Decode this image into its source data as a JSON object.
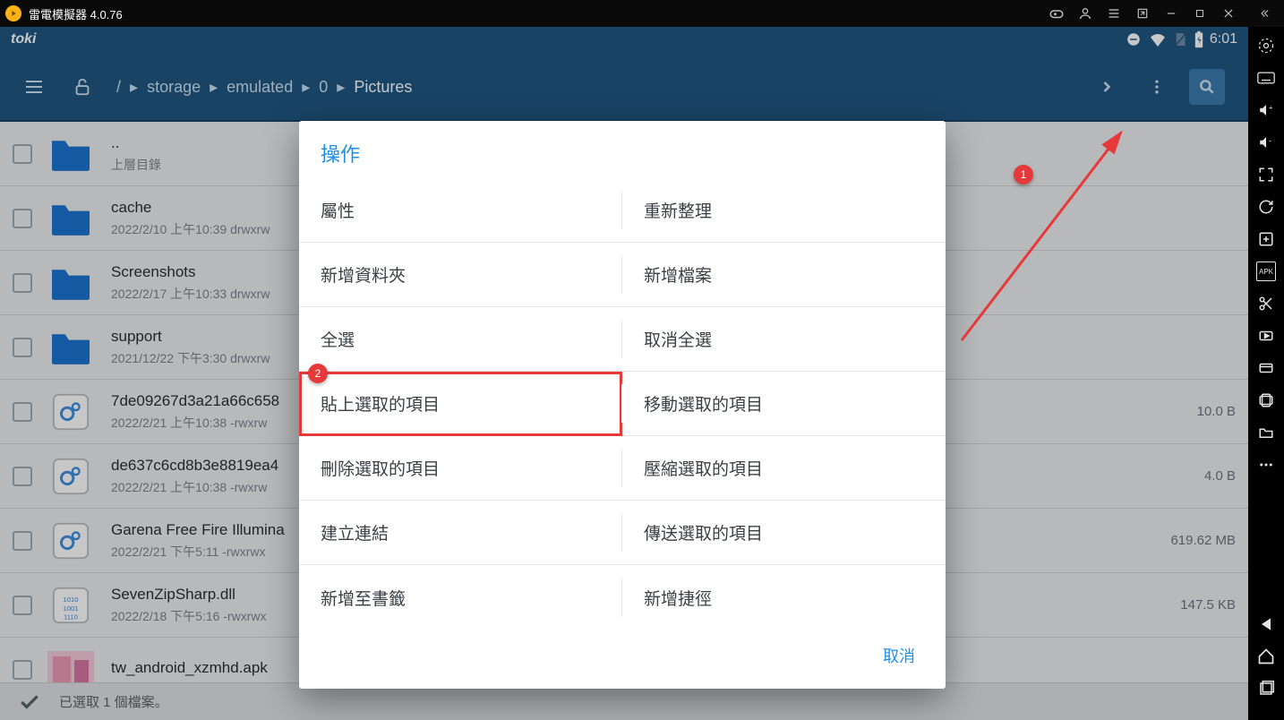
{
  "window": {
    "title": "雷電模擬器 4.0.76"
  },
  "statusbar": {
    "brand": "toki",
    "time": "6:01"
  },
  "breadcrumbs": {
    "root": "/",
    "segs": [
      "storage",
      "emulated",
      "0",
      "Pictures"
    ]
  },
  "files": [
    {
      "name": "..",
      "sub": "上層目錄",
      "type": "folder",
      "size": ""
    },
    {
      "name": "cache",
      "sub": "2022/2/10 上午10:39   drwxrw",
      "type": "folder",
      "size": ""
    },
    {
      "name": "Screenshots",
      "sub": "2022/2/17 上午10:33   drwxrw",
      "type": "folder",
      "size": ""
    },
    {
      "name": "support",
      "sub": "2021/12/22 下午3:30   drwxrw",
      "type": "folder",
      "size": ""
    },
    {
      "name": "7de09267d3a21a66c658",
      "sub": "2022/2/21 上午10:38   -rwxrw",
      "type": "cfg",
      "size": "10.0 B"
    },
    {
      "name": "de637c6cd8b3e8819ea4",
      "sub": "2022/2/21 上午10:38   -rwxrw",
      "type": "cfg",
      "size": "4.0 B"
    },
    {
      "name": "Garena Free Fire Illumina",
      "sub": "2022/2/21 下午5:11   -rwxrwx",
      "type": "cfg",
      "size": "619.62 MB"
    },
    {
      "name": "SevenZipSharp.dll",
      "sub": "2022/2/18 下午5:16   -rwxrwx",
      "type": "bin",
      "size": "147.5 KB"
    },
    {
      "name": "tw_android_xzmhd.apk",
      "sub": "",
      "type": "img",
      "size": ""
    }
  ],
  "bottom": {
    "text": "已選取 1 個檔案。"
  },
  "dialog": {
    "title": "操作",
    "items": [
      "屬性",
      "重新整理",
      "新增資料夾",
      "新增檔案",
      "全選",
      "取消全選",
      "貼上選取的項目",
      "移動選取的項目",
      "刪除選取的項目",
      "壓縮選取的項目",
      "建立連結",
      "傳送選取的項目",
      "新增至書籤",
      "新增捷徑"
    ],
    "cancel": "取消"
  },
  "annotations": {
    "b1": "1",
    "b2": "2"
  }
}
